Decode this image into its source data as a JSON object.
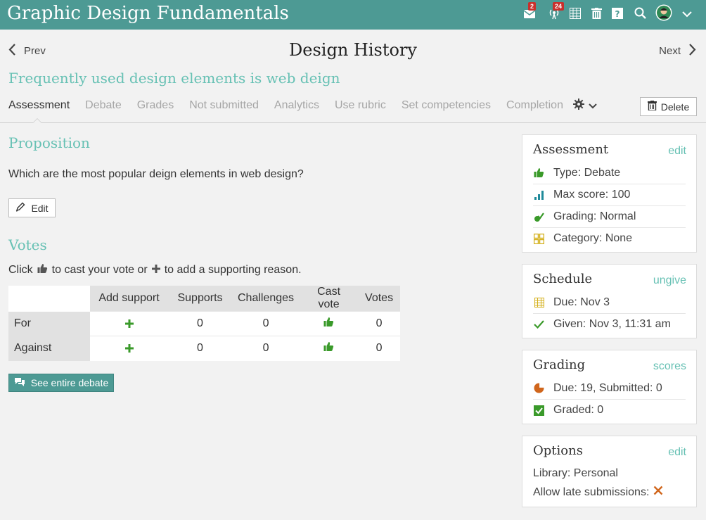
{
  "app": {
    "title": "Graphic Design Fundamentals"
  },
  "topbar": {
    "messages_badge": "2",
    "notifications_badge": "24"
  },
  "nav": {
    "prev": "Prev",
    "next": "Next"
  },
  "page": {
    "title": "Design History",
    "subtitle": "Frequently used design elements is web deign"
  },
  "tabs": [
    {
      "label": "Assessment",
      "active": true
    },
    {
      "label": "Debate"
    },
    {
      "label": "Grades"
    },
    {
      "label": "Not submitted"
    },
    {
      "label": "Analytics"
    },
    {
      "label": "Use rubric"
    },
    {
      "label": "Set competencies"
    },
    {
      "label": "Completion"
    }
  ],
  "toolbar": {
    "delete_label": "Delete"
  },
  "proposition": {
    "title": "Proposition",
    "text": "Which are the most popular deign elements in web design?",
    "edit_label": "Edit"
  },
  "votes": {
    "title": "Votes",
    "hint_click": "Click",
    "hint_mid": "to cast your vote or",
    "hint_end": "to add a supporting reason.",
    "headers": [
      "Add support",
      "Supports",
      "Challenges",
      "Cast vote",
      "Votes"
    ],
    "rows": [
      {
        "label": "For",
        "supports": "0",
        "challenges": "0",
        "votes": "0"
      },
      {
        "label": "Against",
        "supports": "0",
        "challenges": "0",
        "votes": "0"
      }
    ],
    "see_debate_label": "See entire debate"
  },
  "sidebar": {
    "assessment": {
      "title": "Assessment",
      "link": "edit",
      "rows": [
        "Type: Debate",
        "Max score: 100",
        "Grading: Normal",
        "Category: None"
      ]
    },
    "schedule": {
      "title": "Schedule",
      "link": "ungive",
      "rows": [
        "Due: Nov 3",
        "Given: Nov 3, 11:31 am"
      ]
    },
    "grading": {
      "title": "Grading",
      "link": "scores",
      "rows": [
        "Due: 19, Submitted: 0",
        "Graded: 0"
      ]
    },
    "options": {
      "title": "Options",
      "link": "edit",
      "library": "Library: Personal",
      "late": "Allow late submissions:"
    }
  },
  "colors": {
    "topbar": "#4d9a94",
    "accent": "#67c1b4",
    "green": "#3a9a2a",
    "orange": "#d0661c",
    "yellow": "#d4b01c",
    "teal": "#1f8a9a"
  }
}
